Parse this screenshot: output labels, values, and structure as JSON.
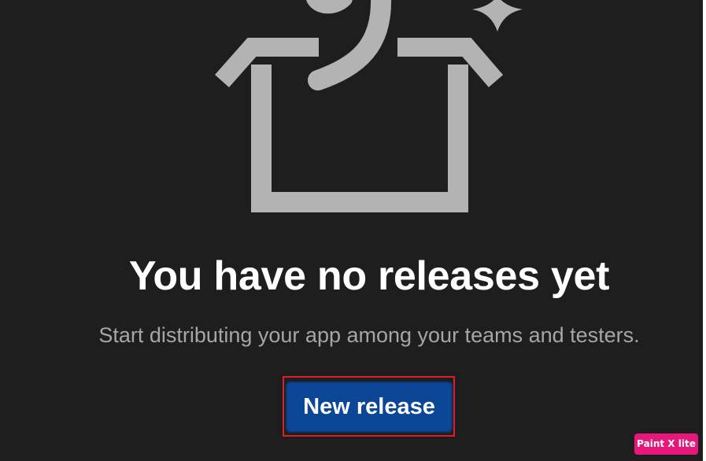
{
  "empty_state": {
    "illustration_icon": "open-box-sparkle-icon",
    "title": "You have no releases yet",
    "subtitle": "Start distributing your app among your teams and testers.",
    "new_release_label": "New release"
  },
  "watermark": {
    "label": "Paint X lite"
  },
  "colors": {
    "background": "#1e1e1e",
    "illustration": "#b3b3b3",
    "title": "#ffffff",
    "subtitle": "#a6a6a6",
    "primary_button": "#0b4796",
    "highlight": "#e01e2a",
    "watermark": "#e7187c"
  }
}
